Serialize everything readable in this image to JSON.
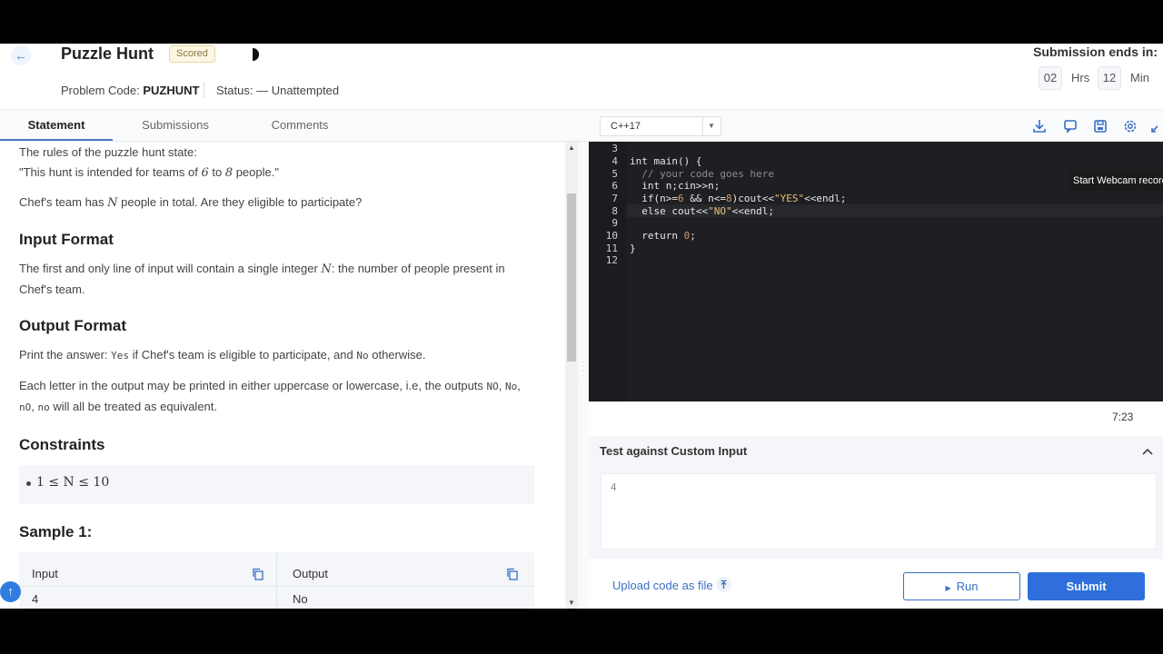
{
  "header": {
    "title": "Puzzle Hunt",
    "badge": "Scored",
    "problem_code_label": "Problem Code:",
    "problem_code": "PUZHUNT",
    "status_label": "Status:",
    "status_value": "— Unattempted",
    "submission_ends": "Submission ends in:",
    "hours": "02",
    "hours_unit": "Hrs",
    "minutes": "12",
    "minutes_unit": "Min"
  },
  "tabs": [
    {
      "label": "Statement"
    },
    {
      "label": "Submissions"
    },
    {
      "label": "Comments"
    }
  ],
  "editor_toolbar": {
    "language": "C++17",
    "icons": [
      "download-icon",
      "chat-icon",
      "save-icon",
      "settings-icon",
      "expand-icon"
    ]
  },
  "statement": {
    "rules_intro": "The rules of the puzzle hunt state:",
    "quote_a": "\"This hunt is intended for teams of ",
    "quote_n1": "6",
    "quote_b": " to ",
    "quote_n2": "8",
    "quote_c": " people.\"",
    "question_a": "Chef's team has ",
    "question_var": "N",
    "question_b": " people in total. Are they eligible to participate?",
    "input_heading": "Input Format",
    "input_a": "The first and only line of input will contain a single integer ",
    "input_var": "N",
    "input_b": ": the number of people present in Chef's team.",
    "output_heading": "Output Format",
    "output_a": "Print the answer: ",
    "output_yes": "Yes",
    "output_b": " if Chef's team is eligible to participate, and ",
    "output_no": "No",
    "output_c": " otherwise.",
    "case_a": "Each letter in the output may be printed in either uppercase or lowercase, i.e, the outputs ",
    "case_v1": "NO",
    "case_s1": ", ",
    "case_v2": "No",
    "case_s2": ", ",
    "case_v3": "nO",
    "case_s3": ", ",
    "case_v4": "no",
    "case_b": " will all be treated as equivalent.",
    "constraints_heading": "Constraints",
    "constraint": "1 ≤ N ≤ 10",
    "sample_heading": "Sample 1:",
    "sample_input_header": "Input",
    "sample_output_header": "Output",
    "sample_input": "4",
    "sample_output": "No"
  },
  "editor": {
    "line_numbers": [
      "3",
      "4",
      "5",
      "6",
      "7",
      "8",
      "9",
      "10",
      "11",
      "12"
    ],
    "lines": [
      {
        "a": "",
        "b": "",
        "c": "",
        "d": "",
        "e": ""
      },
      {
        "a": "int main() {",
        "b": "",
        "c": "",
        "d": "",
        "e": ""
      },
      {
        "a": "  ",
        "b": "// your code goes here",
        "c": "",
        "d": "",
        "e": ""
      },
      {
        "a": "  int n;cin>>n;",
        "b": "",
        "c": "",
        "d": "",
        "e": ""
      },
      {
        "a": "  if(n>=",
        "b": "6",
        "c": " && n<=",
        "d": "8",
        "e": ")cout<<"
      },
      {
        "a": "  else cout<<",
        "b": "\"NO\"",
        "c": "<<endl;",
        "d": "",
        "e": ""
      },
      {
        "a": "",
        "b": "",
        "c": "",
        "d": "",
        "e": ""
      },
      {
        "a": "  return ",
        "b": "0",
        "c": ";",
        "d": "",
        "e": ""
      },
      {
        "a": "}",
        "b": "",
        "c": "",
        "d": "",
        "e": ""
      },
      {
        "a": "",
        "b": "",
        "c": "",
        "d": "",
        "e": ""
      }
    ],
    "line7_str": "\"YES\"",
    "line7_tail": "<<endl;"
  },
  "webcam_tooltip": "Start Webcam recording",
  "time_display": "7:23",
  "custom_input": {
    "title": "Test against Custom Input",
    "value": "4"
  },
  "bottom": {
    "upload_label": "Upload code as file",
    "run_label": "Run",
    "submit_label": "Submit"
  },
  "colors": {
    "accent": "#2f6fdc",
    "editor_bg": "#1e1f22"
  }
}
